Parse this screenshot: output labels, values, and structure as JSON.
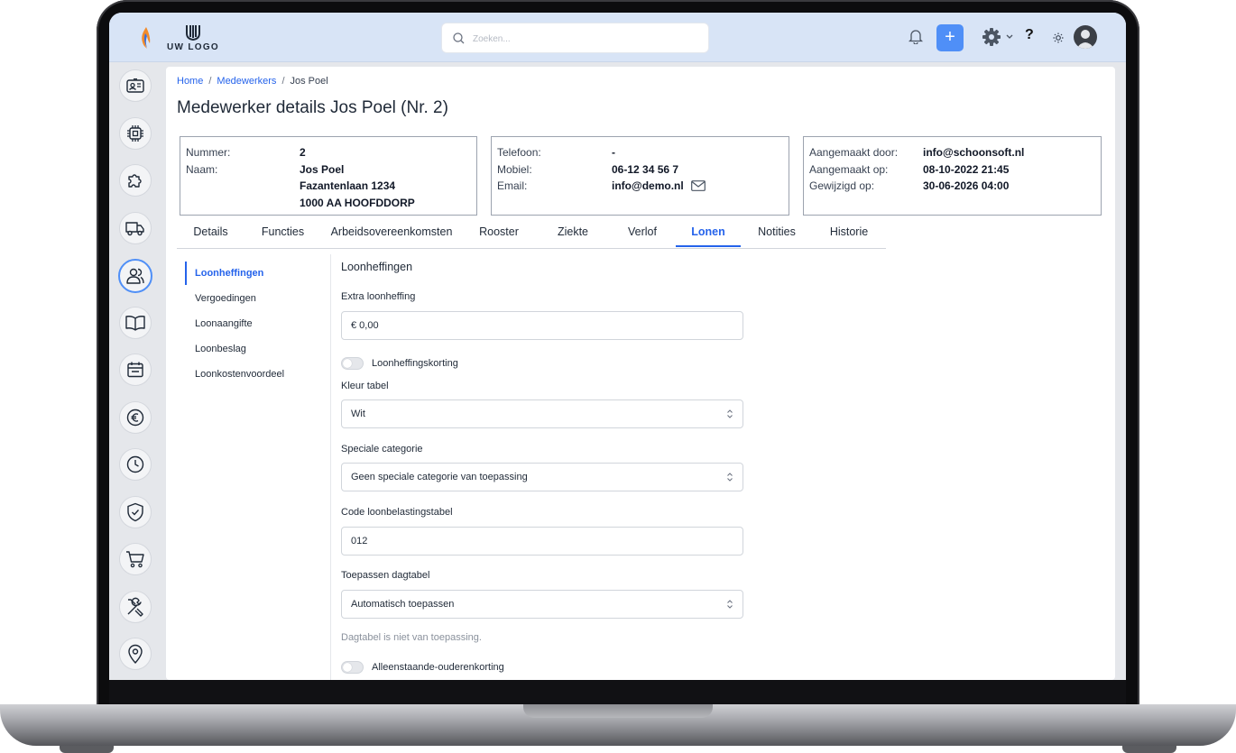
{
  "header": {
    "logo_text": "UW LOGO",
    "search_placeholder": "Zoeken..."
  },
  "breadcrumb": {
    "home": "Home",
    "employees": "Medewerkers",
    "current": "Jos Poel"
  },
  "page_title": "Medewerker details Jos Poel (Nr. 2)",
  "info_personal": {
    "number_label": "Nummer:",
    "number_value": "2",
    "name_label": "Naam:",
    "name_value": "Jos Poel",
    "street": "Fazantenlaan 1234",
    "city": "1000 AA HOOFDDORP"
  },
  "info_contact": {
    "phone_label": "Telefoon:",
    "phone_value": "-",
    "mobile_label": "Mobiel:",
    "mobile_value": "06-12 34 56 7",
    "email_label": "Email:",
    "email_value": "info@demo.nl"
  },
  "info_meta": {
    "created_by_label": "Aangemaakt door:",
    "created_by_value": "info@schoonsoft.nl",
    "created_on_label": "Aangemaakt op:",
    "created_on_value": "08-10-2022 21:45",
    "modified_on_label": "Gewijzigd op:",
    "modified_on_value": "30-06-2026 04:00"
  },
  "tabs": [
    "Details",
    "Functies",
    "Arbeidsovereenkomsten",
    "Rooster",
    "Ziekte",
    "Verlof",
    "Lonen",
    "Notities",
    "Historie"
  ],
  "active_tab": "Lonen",
  "subnav": [
    "Loonheffingen",
    "Vergoedingen",
    "Loonaangifte",
    "Loonbeslag",
    "Loonkostenvoordeel"
  ],
  "form": {
    "title": "Loonheffingen",
    "extra_label": "Extra loonheffing",
    "extra_value": "€ 0,00",
    "discount_toggle_label": "Loonheffingskorting",
    "color_label": "Kleur tabel",
    "color_value": "Wit",
    "category_label": "Speciale categorie",
    "category_value": "Geen speciale categorie van toepassing",
    "code_label": "Code loonbelastingstabel",
    "code_value": "012",
    "daytable_label": "Toepassen dagtabel",
    "daytable_value": "Automatisch toepassen",
    "daytable_hint": "Dagtabel is niet van toepassing.",
    "single_parent_label": "Alleenstaande-ouderenkorting"
  },
  "colors": {
    "accent": "#2563eb",
    "topbar": "#d8e4f6",
    "add_button": "#4f8ff7"
  }
}
